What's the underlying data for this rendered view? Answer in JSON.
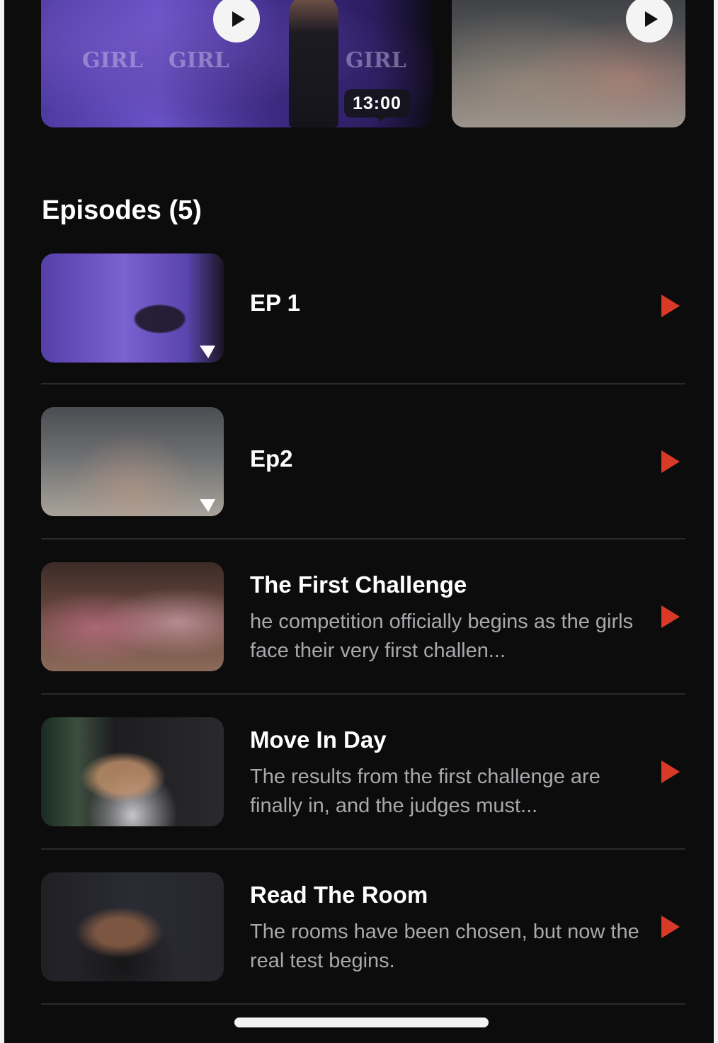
{
  "carousel": [
    {
      "duration": "13:00",
      "brand": "GIRL"
    },
    {
      "brand": ""
    }
  ],
  "episodes_section": {
    "title": "Episodes (5)"
  },
  "episodes": [
    {
      "title": "EP 1",
      "description": ""
    },
    {
      "title": "Ep2",
      "description": ""
    },
    {
      "title": "The First Challenge",
      "description": "he competition officially begins as the girls face their very first challen..."
    },
    {
      "title": "Move In Day",
      "description": "The results from the first challenge are finally in, and the judges must..."
    },
    {
      "title": "Read The Room",
      "description": "The rooms have been chosen, but now the real test begins."
    }
  ],
  "colors": {
    "background": "#0c0c0d",
    "accent": "#d93a28",
    "text": "#ffffff",
    "muted": "#a9a9ad"
  },
  "icons": {
    "card_play": "play-circle-icon",
    "episode_play": "play-triangle-icon"
  }
}
